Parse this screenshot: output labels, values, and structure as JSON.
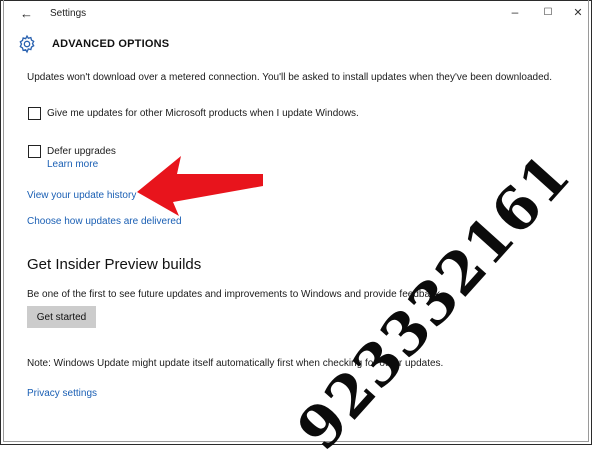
{
  "window": {
    "title": "Settings",
    "minimize_label": "–",
    "maximize_label": "☐",
    "close_label": "✕",
    "back_label": "←"
  },
  "header": {
    "title": "ADVANCED OPTIONS",
    "icon": "gear-icon"
  },
  "main": {
    "metered_note": "Updates won't download over a metered connection. You'll be asked to install updates when they've been downloaded.",
    "options": [
      {
        "label": "Give me updates for other Microsoft products when I update Windows.",
        "checked": false
      },
      {
        "label": "Defer upgrades",
        "checked": false
      }
    ],
    "learn_more": "Learn more",
    "view_history": "View your update history",
    "choose_delivery": "Choose how updates are delivered",
    "insider": {
      "title": "Get Insider Preview builds",
      "description": "Be one of the first to see future updates and improvements to Windows and provide feedback.",
      "button": "Get started"
    },
    "note": "Note: Windows Update might update itself automatically first when checking for other updates.",
    "privacy": "Privacy settings"
  },
  "overlay": {
    "arrow_color": "#e8141c",
    "watermark": "923332161"
  },
  "colors": {
    "link": "#1a5fb4",
    "button_bg": "#cccccc"
  }
}
